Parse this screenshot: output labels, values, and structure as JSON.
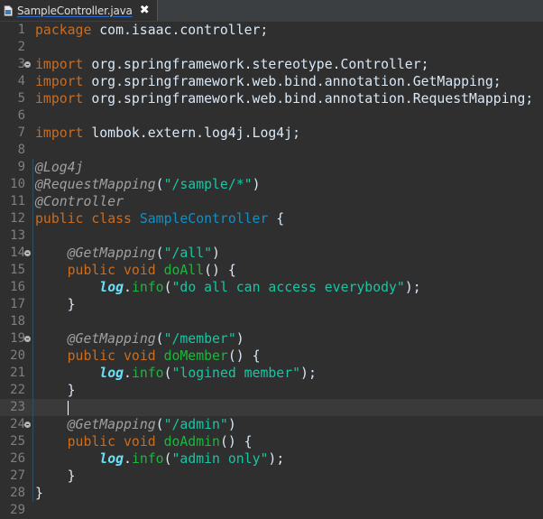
{
  "tab": {
    "title": "SampleController.java",
    "close_symbol": "✖",
    "icon": "java-file-icon"
  },
  "editor": {
    "current_line": 23,
    "lines": [
      {
        "n": "1",
        "fold": false,
        "tokens": [
          [
            "kw",
            "package"
          ],
          [
            "plain",
            " com.isaac.controller;"
          ]
        ]
      },
      {
        "n": "2",
        "fold": false,
        "tokens": []
      },
      {
        "n": "3",
        "fold": true,
        "tokens": [
          [
            "kw",
            "import"
          ],
          [
            "plain",
            " org.springframework.stereotype.Controller;"
          ]
        ]
      },
      {
        "n": "4",
        "fold": false,
        "tokens": [
          [
            "kw",
            "import"
          ],
          [
            "plain",
            " org.springframework.web.bind.annotation.GetMapping;"
          ]
        ]
      },
      {
        "n": "5",
        "fold": false,
        "tokens": [
          [
            "kw",
            "import"
          ],
          [
            "plain",
            " org.springframework.web.bind.annotation.RequestMapping;"
          ]
        ]
      },
      {
        "n": "6",
        "fold": false,
        "tokens": []
      },
      {
        "n": "7",
        "fold": false,
        "tokens": [
          [
            "kw",
            "import"
          ],
          [
            "plain",
            " lombok.extern.log4j.Log4j;"
          ]
        ]
      },
      {
        "n": "8",
        "fold": false,
        "tokens": []
      },
      {
        "n": "9",
        "fold": false,
        "ruler": true,
        "tokens": [
          [
            "ann",
            "@Log4j"
          ]
        ]
      },
      {
        "n": "10",
        "fold": false,
        "ruler": true,
        "tokens": [
          [
            "ann",
            "@RequestMapping"
          ],
          [
            "plain",
            "("
          ],
          [
            "str",
            "\"/sample/*\""
          ],
          [
            "plain",
            ")"
          ]
        ]
      },
      {
        "n": "11",
        "fold": false,
        "ruler": true,
        "tokens": [
          [
            "ann",
            "@Controller"
          ]
        ]
      },
      {
        "n": "12",
        "fold": false,
        "ruler": true,
        "tokens": [
          [
            "kw",
            "public"
          ],
          [
            "plain",
            " "
          ],
          [
            "kw",
            "class"
          ],
          [
            "plain",
            " "
          ],
          [
            "cls",
            "SampleController"
          ],
          [
            "plain",
            " {"
          ]
        ]
      },
      {
        "n": "13",
        "fold": false,
        "ruler": true,
        "tokens": []
      },
      {
        "n": "14",
        "fold": true,
        "ruler": true,
        "tokens": [
          [
            "plain",
            "    "
          ],
          [
            "ann",
            "@GetMapping"
          ],
          [
            "plain",
            "("
          ],
          [
            "str",
            "\"/all\""
          ],
          [
            "plain",
            ")"
          ]
        ]
      },
      {
        "n": "15",
        "fold": false,
        "ruler": true,
        "tokens": [
          [
            "plain",
            "    "
          ],
          [
            "kw",
            "public"
          ],
          [
            "plain",
            " "
          ],
          [
            "kw",
            "void"
          ],
          [
            "plain",
            " "
          ],
          [
            "mth",
            "doAll"
          ],
          [
            "plain",
            "() {"
          ]
        ]
      },
      {
        "n": "16",
        "fold": false,
        "ruler": true,
        "tokens": [
          [
            "plain",
            "        "
          ],
          [
            "fld",
            "log"
          ],
          [
            "plain",
            "."
          ],
          [
            "mth",
            "info"
          ],
          [
            "plain",
            "("
          ],
          [
            "str",
            "\"do all can access everybody\""
          ],
          [
            "plain",
            ");"
          ]
        ]
      },
      {
        "n": "17",
        "fold": false,
        "ruler": true,
        "tokens": [
          [
            "plain",
            "    }"
          ]
        ]
      },
      {
        "n": "18",
        "fold": false,
        "ruler": true,
        "tokens": []
      },
      {
        "n": "19",
        "fold": true,
        "ruler": true,
        "tokens": [
          [
            "plain",
            "    "
          ],
          [
            "ann",
            "@GetMapping"
          ],
          [
            "plain",
            "("
          ],
          [
            "str",
            "\"/member\""
          ],
          [
            "plain",
            ")"
          ]
        ]
      },
      {
        "n": "20",
        "fold": false,
        "ruler": true,
        "tokens": [
          [
            "plain",
            "    "
          ],
          [
            "kw",
            "public"
          ],
          [
            "plain",
            " "
          ],
          [
            "kw",
            "void"
          ],
          [
            "plain",
            " "
          ],
          [
            "mth",
            "doMember"
          ],
          [
            "plain",
            "() {"
          ]
        ]
      },
      {
        "n": "21",
        "fold": false,
        "ruler": true,
        "tokens": [
          [
            "plain",
            "        "
          ],
          [
            "fld",
            "log"
          ],
          [
            "plain",
            "."
          ],
          [
            "mth",
            "info"
          ],
          [
            "plain",
            "("
          ],
          [
            "str",
            "\"logined member\""
          ],
          [
            "plain",
            ");"
          ]
        ]
      },
      {
        "n": "22",
        "fold": false,
        "ruler": true,
        "tokens": [
          [
            "plain",
            "    }"
          ]
        ]
      },
      {
        "n": "23",
        "fold": false,
        "ruler": true,
        "caret": true,
        "tokens": [
          [
            "plain",
            "    "
          ]
        ]
      },
      {
        "n": "24",
        "fold": true,
        "ruler": true,
        "tokens": [
          [
            "plain",
            "    "
          ],
          [
            "ann",
            "@GetMapping"
          ],
          [
            "plain",
            "("
          ],
          [
            "str",
            "\"/admin\""
          ],
          [
            "plain",
            ")"
          ]
        ]
      },
      {
        "n": "25",
        "fold": false,
        "ruler": true,
        "tokens": [
          [
            "plain",
            "    "
          ],
          [
            "kw",
            "public"
          ],
          [
            "plain",
            " "
          ],
          [
            "kw",
            "void"
          ],
          [
            "plain",
            " "
          ],
          [
            "mth",
            "doAdmin"
          ],
          [
            "plain",
            "() {"
          ]
        ]
      },
      {
        "n": "26",
        "fold": false,
        "ruler": true,
        "tokens": [
          [
            "plain",
            "        "
          ],
          [
            "fld",
            "log"
          ],
          [
            "plain",
            "."
          ],
          [
            "mth",
            "info"
          ],
          [
            "plain",
            "("
          ],
          [
            "str",
            "\"admin only\""
          ],
          [
            "plain",
            ");"
          ]
        ]
      },
      {
        "n": "27",
        "fold": false,
        "ruler": true,
        "tokens": [
          [
            "plain",
            "    }"
          ]
        ]
      },
      {
        "n": "28",
        "fold": false,
        "ruler": true,
        "tokens": [
          [
            "plain",
            "}"
          ]
        ]
      },
      {
        "n": "29",
        "fold": false,
        "tokens": []
      }
    ]
  },
  "colors": {
    "background": "#2f2f2f",
    "keyword": "#cc6c1d",
    "annotation": "#a0a0a0",
    "string": "#17c6a3",
    "class_name": "#1290c3",
    "method": "#1eb540",
    "static_field": "#66e1f8",
    "line_number": "#7f7f7f"
  }
}
